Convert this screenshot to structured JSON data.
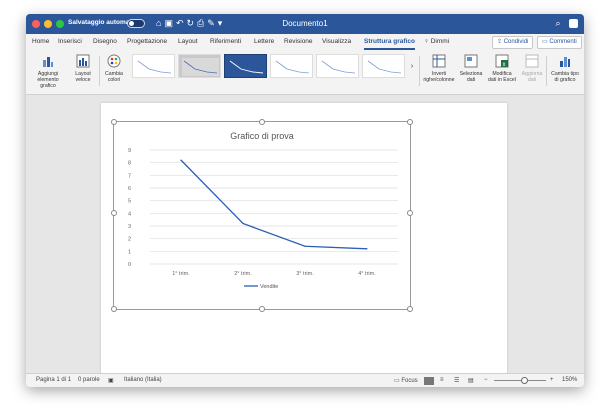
{
  "titlebar": {
    "autosave_label": "Salvataggio automatico",
    "document_title": "Documento1"
  },
  "tabs": [
    {
      "label": "Home"
    },
    {
      "label": "Inserisci"
    },
    {
      "label": "Disegno"
    },
    {
      "label": "Progettazione"
    },
    {
      "label": "Layout"
    },
    {
      "label": "Riferimenti"
    },
    {
      "label": "Lettere"
    },
    {
      "label": "Revisione"
    },
    {
      "label": "Visualizza"
    },
    {
      "label": "Struttura grafico",
      "active": true
    }
  ],
  "tell_me": "Dimmi",
  "share_button": "Condividi",
  "comments_button": "Commenti",
  "ribbon": {
    "add_element": [
      "Aggiungi",
      "elemento grafico"
    ],
    "quick_layout": [
      "Layout",
      "veloce"
    ],
    "change_colors": [
      "Cambia",
      "colori"
    ],
    "switch_row_column": [
      "Inverti",
      "righe/colonne"
    ],
    "select_data": [
      "Seleziona",
      "dati"
    ],
    "edit_data_excel": [
      "Modifica",
      "dati in Excel"
    ],
    "refresh_data": [
      "Aggiorna",
      "dati"
    ],
    "change_chart_type": [
      "Cambia tipo",
      "di grafico"
    ]
  },
  "chart_data": {
    "type": "line",
    "title": "Grafico di prova",
    "categories": [
      "1° trim.",
      "2° trim.",
      "3° trim.",
      "4° trim."
    ],
    "series": [
      {
        "name": "Vendite",
        "values": [
          8.2,
          3.2,
          1.4,
          1.2
        ],
        "color": "#2b5fb5"
      }
    ],
    "ylim": [
      0,
      9
    ],
    "yticks": [
      0,
      1,
      2,
      3,
      4,
      5,
      6,
      7,
      8,
      9
    ],
    "grid": true,
    "legend": "bottom"
  },
  "statusbar": {
    "page": "Pagina 1 di 1",
    "words": "0 parole",
    "language": "Italiano (Italia)",
    "focus": "Focus",
    "zoom": "150%"
  }
}
